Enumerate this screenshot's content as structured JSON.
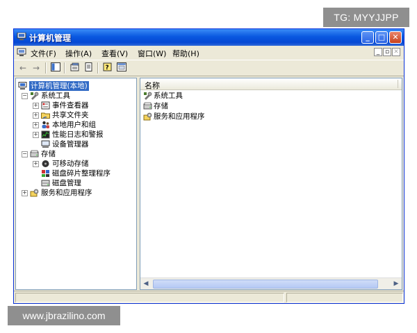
{
  "watermarks": {
    "top": "TG: MYYJJPP",
    "bottom": "www.jbrazilino.com"
  },
  "window": {
    "title": "计算机管理"
  },
  "menubar": {
    "items": [
      {
        "label": "文件(F)"
      },
      {
        "label": "操作(A)"
      },
      {
        "label": "查看(V)"
      },
      {
        "label": "窗口(W)"
      },
      {
        "label": "帮助(H)"
      }
    ]
  },
  "tree": {
    "root": "计算机管理(本地)",
    "system_tools": "系统工具",
    "event_viewer": "事件查看器",
    "shared_folders": "共享文件夹",
    "local_users": "本地用户和组",
    "perf_logs": "性能日志和警报",
    "device_manager": "设备管理器",
    "storage": "存储",
    "removable_storage": "可移动存储",
    "defrag": "磁盘碎片整理程序",
    "disk_mgmt": "磁盘管理",
    "services_apps": "服务和应用程序"
  },
  "list": {
    "column_name": "名称",
    "items": [
      {
        "label": "系统工具"
      },
      {
        "label": "存储"
      },
      {
        "label": "服务和应用程序"
      }
    ]
  },
  "icons": {
    "title": "computer-management-icon",
    "folder": "folder-icon",
    "tools": "tools-icon"
  },
  "colors": {
    "titlebar": "#0a58e0",
    "selection": "#316ac5",
    "chrome": "#ece9d8"
  }
}
